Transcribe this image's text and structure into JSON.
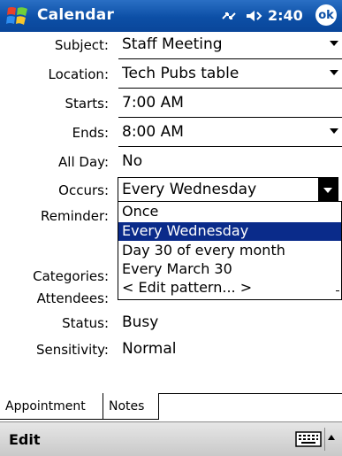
{
  "titlebar": {
    "app_title": "Calendar",
    "clock": "2:40",
    "ok_label": "ok",
    "icons": [
      "start-flag-icon",
      "connectivity-icon",
      "volume-icon"
    ]
  },
  "form": {
    "subject": {
      "label": "Subject:",
      "value": "Staff Meeting"
    },
    "location": {
      "label": "Location:",
      "value": "Tech Pubs table"
    },
    "starts": {
      "label": "Starts:",
      "value": "7:00 AM"
    },
    "ends": {
      "label": "Ends:",
      "value": "8:00 AM"
    },
    "all_day": {
      "label": "All Day:",
      "value": "No"
    },
    "occurs": {
      "label": "Occurs:",
      "value": "Every Wednesday"
    },
    "reminder": {
      "label": "Reminder:"
    },
    "categories": {
      "label": "Categories:"
    },
    "attendees": {
      "label": "Attendees:"
    },
    "status": {
      "label": "Status:",
      "value": "Busy"
    },
    "sensitivity": {
      "label": "Sensitivity:",
      "value": "Normal"
    }
  },
  "occurs_dropdown": {
    "options": [
      "Once",
      "Every Wednesday",
      "Day 30 of every month",
      "Every March 30",
      "< Edit pattern... >"
    ],
    "selected": "Every Wednesday"
  },
  "tabs": [
    "Appointment",
    "Notes"
  ],
  "menubar": {
    "edit": "Edit",
    "input_icon": "keyboard-icon"
  },
  "colors": {
    "titlebar": "#0c4fa6",
    "selection": "#0a2b8a",
    "menubar": "#d6d6d6"
  }
}
